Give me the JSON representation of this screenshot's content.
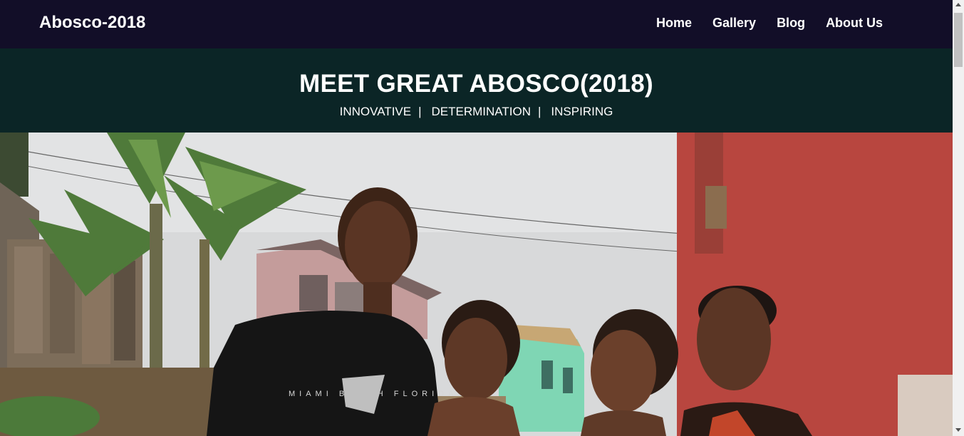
{
  "navbar": {
    "brand": "Abosco-2018",
    "links": [
      {
        "label": "Home"
      },
      {
        "label": "Gallery"
      },
      {
        "label": "Blog"
      },
      {
        "label": "About Us"
      }
    ]
  },
  "hero": {
    "title": "MEET GREAT ABOSCO(2018)",
    "tags": [
      "INNOVATIVE",
      "DETERMINATION",
      "INSPIRING"
    ],
    "separator": "|"
  },
  "photo": {
    "shirt_text": "MIAMI BEACH FLORIDA"
  },
  "colors": {
    "navbar_bg": "#120e28",
    "hero_bg": "#0b2526",
    "text": "#ffffff"
  }
}
